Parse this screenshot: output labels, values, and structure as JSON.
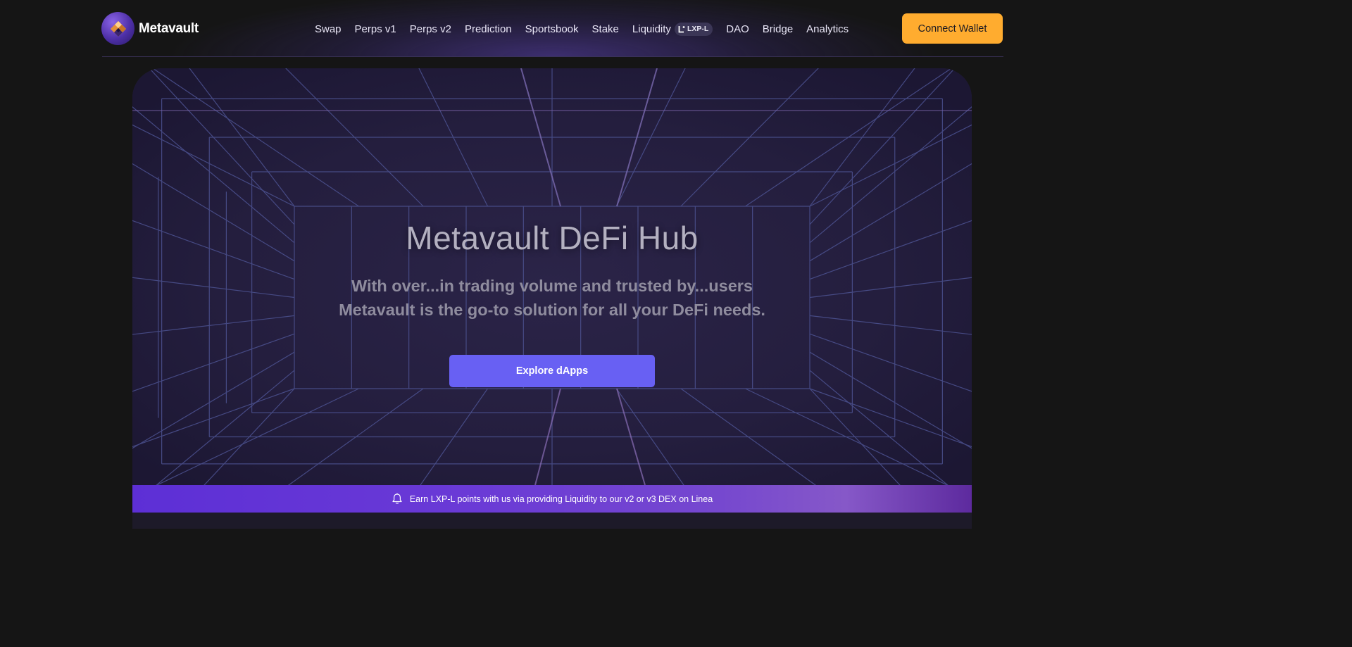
{
  "header": {
    "logo_text": "Metavault",
    "nav": [
      {
        "label": "Swap"
      },
      {
        "label": "Perps v1"
      },
      {
        "label": "Perps v2"
      },
      {
        "label": "Prediction"
      },
      {
        "label": "Sportsbook"
      },
      {
        "label": "Stake"
      },
      {
        "label": "Liquidity",
        "badge": "LXP-L"
      },
      {
        "label": "DAO"
      },
      {
        "label": "Bridge"
      },
      {
        "label": "Analytics"
      }
    ],
    "connect_label": "Connect Wallet"
  },
  "hero": {
    "title": "Metavault DeFi Hub",
    "subtitle_line1": "With over...in trading volume and trusted by...users",
    "subtitle_line2": "Metavault is the go-to solution for all your DeFi needs.",
    "cta_label": "Explore dApps"
  },
  "banner": {
    "text": "Earn LXP-L points with us via providing Liquidity to our v2 or v3 DEX on Linea",
    "icon": "bell-icon"
  },
  "colors": {
    "accent": "#ffac2f",
    "cta": "#6860f3",
    "banner": "#6a3ad6",
    "background": "#151515"
  }
}
